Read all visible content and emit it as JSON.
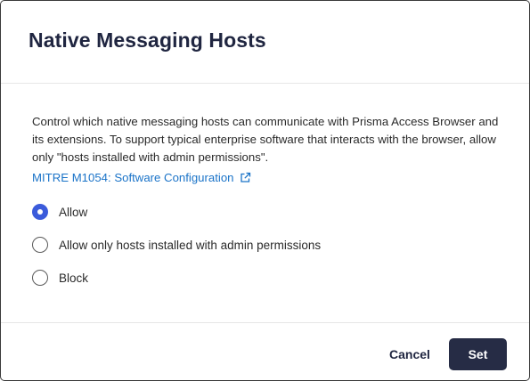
{
  "dialog": {
    "title": "Native Messaging Hosts",
    "description": "Control which native messaging hosts can communicate with Prisma Access Browser and its extensions. To support typical enterprise software that interacts with the browser, allow only \"hosts installed with admin permissions\".",
    "reference_link": {
      "label": "MITRE M1054: Software Configuration",
      "icon": "external-link-icon"
    },
    "options": [
      {
        "label": "Allow",
        "selected": true
      },
      {
        "label": "Allow only hosts installed with admin permissions",
        "selected": false
      },
      {
        "label": "Block",
        "selected": false
      }
    ],
    "footer": {
      "cancel_label": "Cancel",
      "set_label": "Set"
    }
  },
  "colors": {
    "title": "#1f2540",
    "link": "#1a73c8",
    "radio_selected": "#3b5bdb",
    "primary_button": "#262c45"
  }
}
